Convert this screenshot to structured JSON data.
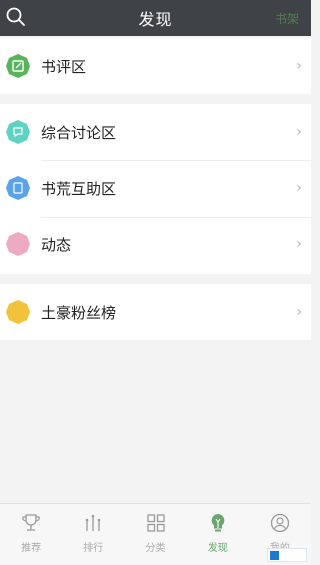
{
  "header": {
    "title": "发现",
    "right_label": "书架"
  },
  "groups": [
    {
      "items": [
        {
          "label": "书评区",
          "icon": "edit-icon",
          "color": "#57b45a"
        }
      ]
    },
    {
      "items": [
        {
          "label": "综合讨论区",
          "icon": "discussion-icon",
          "color": "#5fd3c3"
        },
        {
          "label": "书荒互助区",
          "icon": "book-icon",
          "color": "#5aa3e8"
        },
        {
          "label": "动态",
          "icon": "activity-icon",
          "color": "#eea9c3"
        }
      ]
    },
    {
      "items": [
        {
          "label": "土豪粉丝榜",
          "icon": "coin-icon",
          "color": "#f2c23a"
        }
      ]
    }
  ],
  "tabbar": [
    {
      "label": "推荐",
      "icon": "trophy-icon",
      "active": false
    },
    {
      "label": "排行",
      "icon": "ranking-icon",
      "active": false
    },
    {
      "label": "分类",
      "icon": "grid-icon",
      "active": false
    },
    {
      "label": "发现",
      "icon": "discover-icon",
      "active": true
    },
    {
      "label": "我的",
      "icon": "user-icon",
      "active": false
    }
  ],
  "colors": {
    "header_bg": "#3f4246",
    "accent": "#6aa46e"
  }
}
